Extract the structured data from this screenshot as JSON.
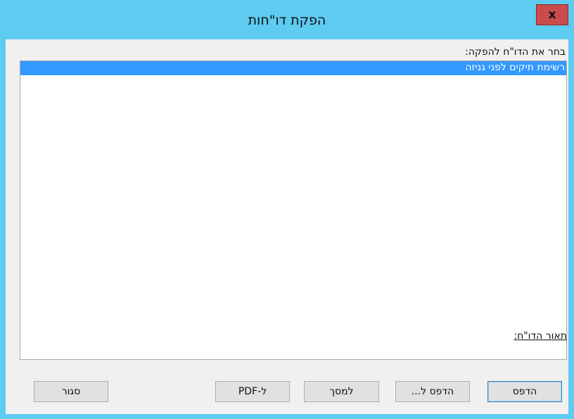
{
  "window": {
    "title": "הפקת דו\"חות",
    "close_label": "x"
  },
  "main": {
    "prompt_label": "בחר את הדו\"ח להפקה:",
    "reports": [
      {
        "label": "רשימת תיקים לפני גניזה",
        "selected": true
      }
    ],
    "description_label": "תאור הדו\"ח:"
  },
  "buttons": {
    "print": "הדפס",
    "print_to": "הדפס ל...",
    "to_screen": "למסך",
    "to_pdf": "ל-PDF",
    "close": "סגור"
  },
  "colors": {
    "titlebar": "#5ecbf0",
    "close_button": "#c94c4c",
    "selection": "#3399ff"
  }
}
